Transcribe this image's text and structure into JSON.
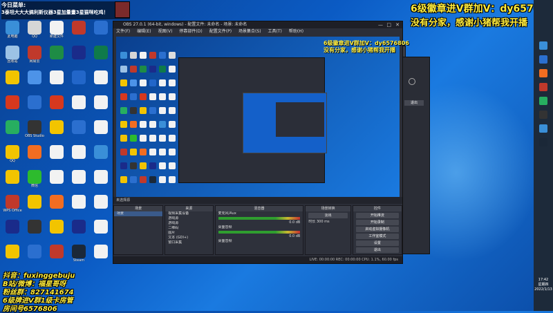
{
  "overlay": {
    "line1": "今日菜单:",
    "line2": "3泰坦大大大搞利斯仪器3星加量畫3星猫咪吃鸡！",
    "right_line1": "6级徽章进V群加V：dy6576806",
    "right_line2": "没有分家，感谢小猪帮我开播",
    "bottom_lines": [
      "抖音：fuxinggebuju",
      "B站/微博：福星哥呀",
      "粉丝群：827141674",
      "6级牌进V群1级卡房管",
      "房间号6576806"
    ]
  },
  "desktop_icons": [
    {
      "label": "此电脑",
      "color": "#3a8fd8"
    },
    {
      "label": "QQ",
      "color": "#d6d6d6"
    },
    {
      "label": "新建文件",
      "color": "#f2f2f2"
    },
    {
      "label": "",
      "color": "#c0392b"
    },
    {
      "label": "",
      "color": "#2b6fcf"
    },
    {
      "label": "",
      "color": "#ddd"
    },
    {
      "label": "回收站",
      "color": "#9cc2e5"
    },
    {
      "label": "网易云",
      "color": "#c0392b"
    },
    {
      "label": "",
      "color": "#1e8c45"
    },
    {
      "label": "",
      "color": "#1a2b8a"
    },
    {
      "label": "",
      "color": "#0f7a4a"
    },
    {
      "label": "",
      "color": "#f2f2f2"
    },
    {
      "label": "",
      "color": "#f2c400"
    },
    {
      "label": "",
      "color": "#4d93e8"
    },
    {
      "label": "",
      "color": "#f2f2f2"
    },
    {
      "label": "",
      "color": "#2266c9"
    },
    {
      "label": "",
      "color": "#f2f2f2"
    },
    {
      "label": "",
      "color": "#f2f2f2"
    },
    {
      "label": "",
      "color": "#d6381e"
    },
    {
      "label": "",
      "color": "#2b6fcf"
    },
    {
      "label": "",
      "color": "#d6381e"
    },
    {
      "label": "",
      "color": "#f2f2f2"
    },
    {
      "label": "",
      "color": "#f2f2f2"
    },
    {
      "label": "",
      "color": "#f2f2f2"
    },
    {
      "label": "",
      "color": "#27ae60"
    },
    {
      "label": "OBS Studio",
      "color": "#333"
    },
    {
      "label": "",
      "color": "#f2c400"
    },
    {
      "label": "",
      "color": "#2b6fcf"
    },
    {
      "label": "",
      "color": "#f2f2f2"
    },
    {
      "label": "",
      "color": "#f2f2f2"
    },
    {
      "label": "QQ",
      "color": "#f2c400"
    },
    {
      "label": "",
      "color": "#f26d21"
    },
    {
      "label": "",
      "color": "#f2f2f2"
    },
    {
      "label": "",
      "color": "#f2f2f2"
    },
    {
      "label": "",
      "color": "#3a8fd8"
    },
    {
      "label": "",
      "color": "#f2f2f2"
    },
    {
      "label": "",
      "color": "#f2c400"
    },
    {
      "label": "微信",
      "color": "#2dbb2d"
    },
    {
      "label": "",
      "color": "#f2f2f2"
    },
    {
      "label": "",
      "color": "#f2f2f2"
    },
    {
      "label": "",
      "color": "#f2f2f2"
    },
    {
      "label": "",
      "color": "#f2f2f2"
    },
    {
      "label": "WPS Office",
      "color": "#c0392b"
    },
    {
      "label": "",
      "color": "#f2c400"
    },
    {
      "label": "",
      "color": "#f26d21"
    },
    {
      "label": "",
      "color": "#f2f2f2"
    },
    {
      "label": "",
      "color": "#f2f2f2"
    },
    {
      "label": "",
      "color": "#f2f2f2"
    },
    {
      "label": "",
      "color": "#1a2b8a"
    },
    {
      "label": "",
      "color": "#333"
    },
    {
      "label": "",
      "color": "#f2c400"
    },
    {
      "label": "",
      "color": "#1a2b8a"
    },
    {
      "label": "",
      "color": "#f2f2f2"
    },
    {
      "label": "",
      "color": "#f2f2f2"
    },
    {
      "label": "",
      "color": "#f2c400"
    },
    {
      "label": "",
      "color": "#2b6fcf"
    },
    {
      "label": "",
      "color": "#c0392b"
    },
    {
      "label": "Steam",
      "color": "#1b2838"
    },
    {
      "label": "",
      "color": "#f2f2f2"
    },
    {
      "label": "",
      "color": "#f2f2f2"
    }
  ],
  "obs": {
    "title": "OBS 27.0.1 (64-bit, windows) - 配置文件: 未命名 - 场景: 未命名",
    "menu": [
      "文件(F)",
      "编辑(E)",
      "视图(V)",
      "停靠部件(D)",
      "配置文件(P)",
      "场景集合(S)",
      "工具(T)",
      "帮助(H)"
    ],
    "preview_text1": "6级徽章进V群加V：dy6576806",
    "preview_text2": "没有分家，感谢小猪帮我开播",
    "source_bar": "未选择源",
    "docks": {
      "scenes": {
        "title": "场景",
        "items": [
          "场景"
        ]
      },
      "sources": {
        "title": "来源",
        "items": [
          "视频采集设备",
          "游戏源",
          "游戏源",
          "二维码",
          "图片",
          "文本 (GDI+)",
          "窗口采集"
        ]
      },
      "mixer": {
        "title": "混音器",
        "items": [
          {
            "label": "麦克风/Aux",
            "value": "0.0 dB"
          },
          {
            "label": "桌面音频",
            "value": "0.0 dB"
          },
          {
            "label": "桌面音频",
            "value": "0.0 dB"
          }
        ]
      },
      "transitions": {
        "title": "场景转换",
        "type": "淡出",
        "duration_label": "时长",
        "duration": "300 ms"
      },
      "controls": {
        "title": "控件",
        "buttons": [
          "开始推流",
          "开始录制",
          "启动虚拟摄像机",
          "工作室模式",
          "设置",
          "退出"
        ]
      }
    },
    "status": "LIVE: 00:00:00   REC: 00:00:00   CPU: 1.1%, 60.00 fps"
  },
  "side_window": {
    "buttons": [
      "退出"
    ]
  },
  "clock": {
    "time": "17:42",
    "day": "星期四",
    "date": "2022/1/13"
  }
}
